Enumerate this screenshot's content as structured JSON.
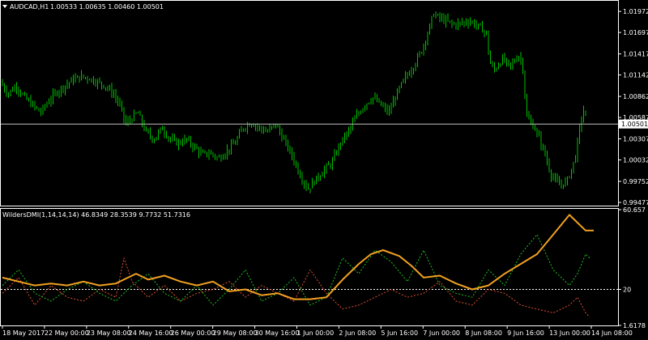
{
  "colors": {
    "background": "#000000",
    "panel_border": "#ffffff",
    "candle": "#00c000",
    "price_line": "#c0c0c0",
    "adx": "#f0a020",
    "dmi_line": "#a8d8e8",
    "plus_di": "#20c020",
    "minus_di": "#e05030",
    "text": "#ffffff"
  },
  "header": {
    "arrow_icon": "triangle-down-icon",
    "symbol": "AUDCAD,H1",
    "ohlc": "1.00533 1.00635 1.00460 1.00501"
  },
  "indicator_header": "WildersDMI(1,14,14,14) 46.8349 28.3539 9.7732 51.7316",
  "current_price_label": "1.00501",
  "chart_data": [
    {
      "type": "candlestick",
      "symbol": "AUDCAD",
      "timeframe": "H1",
      "ylim": [
        0.99435,
        1.021
      ],
      "y_ticks": [
        "1.01972",
        "1.01697",
        "1.01417",
        "1.01142",
        "1.00862",
        "1.00587",
        "1.00307",
        "1.00032",
        "0.99752",
        "0.99477"
      ],
      "y_tick_values": [
        1.01972,
        1.01697,
        1.01417,
        1.01142,
        1.00862,
        1.00587,
        1.00307,
        1.00032,
        0.99752,
        0.99477
      ],
      "current_price": 1.00501,
      "x_ticks": [
        "18 May 2017",
        "22 May 00:00",
        "23 May 08:00",
        "24 May 16:00",
        "26 May 00:00",
        "29 May 08:00",
        "30 May 16:00",
        "1 Jun 00:00",
        "2 Jun 08:00",
        "5 Jun 16:00",
        "7 Jun 00:00",
        "8 Jun 08:00",
        "9 Jun 16:00",
        "13 Jun 00:00",
        "14 Jun 08:00"
      ],
      "close_path": [
        [
          0,
          1.0105
        ],
        [
          10,
          1.009
        ],
        [
          20,
          1.01
        ],
        [
          30,
          1.0085
        ],
        [
          40,
          1.0075
        ],
        [
          50,
          1.0065
        ],
        [
          60,
          1.008
        ],
        [
          70,
          1.0092
        ],
        [
          80,
          1.01
        ],
        [
          90,
          1.0108
        ],
        [
          100,
          1.0112
        ],
        [
          110,
          1.011
        ],
        [
          120,
          1.0105
        ],
        [
          130,
          1.01
        ],
        [
          140,
          1.009
        ],
        [
          150,
          1.007
        ],
        [
          155,
          1.005
        ],
        [
          160,
          1.0055
        ],
        [
          170,
          1.0065
        ],
        [
          180,
          1.004
        ],
        [
          190,
          1.003
        ],
        [
          200,
          1.0045
        ],
        [
          210,
          1.003
        ],
        [
          220,
          1.0025
        ],
        [
          230,
          1.003
        ],
        [
          240,
          1.002
        ],
        [
          250,
          1.001
        ],
        [
          260,
          1.0012
        ],
        [
          270,
          1.0005
        ],
        [
          280,
          1.0015
        ],
        [
          290,
          1.0025
        ],
        [
          300,
          1.0045
        ],
        [
          310,
          1.0052
        ],
        [
          320,
          1.0045
        ],
        [
          330,
          1.004
        ],
        [
          340,
          1.005
        ],
        [
          350,
          1.003
        ],
        [
          360,
          1.001
        ],
        [
          370,
          0.9985
        ],
        [
          380,
          0.9965
        ],
        [
          390,
          0.9978
        ],
        [
          400,
          0.999
        ],
        [
          410,
          1.0
        ],
        [
          420,
          1.0025
        ],
        [
          430,
          1.004
        ],
        [
          440,
          1.006
        ],
        [
          450,
          1.0075
        ],
        [
          460,
          1.0085
        ],
        [
          470,
          1.0075
        ],
        [
          480,
          1.0065
        ],
        [
          490,
          1.009
        ],
        [
          500,
          1.011
        ],
        [
          510,
          1.0125
        ],
        [
          520,
          1.0145
        ],
        [
          530,
          1.0175
        ],
        [
          535,
          1.0195
        ],
        [
          540,
          1.019
        ],
        [
          550,
          1.0185
        ],
        [
          560,
          1.018
        ],
        [
          570,
          1.0182
        ],
        [
          580,
          1.0185
        ],
        [
          590,
          1.0178
        ],
        [
          600,
          1.017
        ],
        [
          605,
          1.013
        ],
        [
          610,
          1.012
        ],
        [
          620,
          1.0135
        ],
        [
          630,
          1.0125
        ],
        [
          640,
          1.014
        ],
        [
          645,
          1.013
        ],
        [
          650,
          1.006
        ],
        [
          660,
          1.0045
        ],
        [
          670,
          1.002
        ],
        [
          680,
          0.9985
        ],
        [
          690,
          0.997
        ],
        [
          700,
          0.9975
        ],
        [
          710,
          1.0005
        ],
        [
          715,
          1.004
        ],
        [
          720,
          1.007
        ],
        [
          725,
          1.005
        ]
      ]
    },
    {
      "type": "line",
      "name": "WildersDMI(1,14,14,14)",
      "values_printed": [
        46.8349,
        28.3539,
        9.7732,
        51.7316
      ],
      "ylim": [
        1.6178,
        60.657
      ],
      "y_ticks": [
        "60.657",
        "20",
        "1.6178"
      ],
      "y_tick_values": [
        60.657,
        20,
        1.6178
      ],
      "level": 20,
      "series": [
        {
          "key": "adx",
          "points": [
            [
              0,
              26
            ],
            [
              20,
              24
            ],
            [
              40,
              22
            ],
            [
              60,
              23
            ],
            [
              80,
              22
            ],
            [
              100,
              24
            ],
            [
              120,
              22
            ],
            [
              140,
              23
            ],
            [
              155,
              26
            ],
            [
              165,
              28
            ],
            [
              180,
              25
            ],
            [
              200,
              27
            ],
            [
              220,
              24
            ],
            [
              240,
              22
            ],
            [
              260,
              24
            ],
            [
              280,
              19
            ],
            [
              300,
              20
            ],
            [
              320,
              17
            ],
            [
              340,
              18
            ],
            [
              360,
              15
            ],
            [
              380,
              15
            ],
            [
              400,
              16
            ],
            [
              420,
              25
            ],
            [
              440,
              33
            ],
            [
              455,
              38
            ],
            [
              470,
              40
            ],
            [
              490,
              37
            ],
            [
              505,
              32
            ],
            [
              520,
              26
            ],
            [
              540,
              27
            ],
            [
              560,
              23
            ],
            [
              580,
              20
            ],
            [
              600,
              22
            ],
            [
              620,
              28
            ],
            [
              640,
              33
            ],
            [
              660,
              38
            ],
            [
              680,
              48
            ],
            [
              700,
              58
            ],
            [
              710,
              54
            ],
            [
              720,
              50
            ],
            [
              730,
              50
            ]
          ]
        },
        {
          "key": "dmi",
          "points": [
            [
              0,
              25
            ],
            [
              15,
              30
            ],
            [
              30,
              20
            ],
            [
              50,
              15
            ],
            [
              70,
              21
            ],
            [
              90,
              18
            ],
            [
              110,
              22
            ],
            [
              130,
              20
            ],
            [
              150,
              24
            ],
            [
              170,
              30
            ],
            [
              180,
              28
            ],
            [
              200,
              24
            ],
            [
              220,
              20
            ],
            [
              240,
              26
            ],
            [
              260,
              22
            ],
            [
              280,
              18
            ],
            [
              300,
              21
            ],
            [
              320,
              16
            ],
            [
              340,
              18
            ],
            [
              360,
              19
            ],
            [
              380,
              22
            ],
            [
              400,
              17
            ],
            [
              410,
              20
            ],
            [
              420,
              32
            ],
            [
              430,
              30
            ],
            [
              440,
              38
            ],
            [
              450,
              40
            ],
            [
              460,
              44
            ],
            [
              470,
              43
            ],
            [
              480,
              35
            ],
            [
              490,
              28
            ],
            [
              500,
              24
            ],
            [
              510,
              30
            ],
            [
              520,
              30
            ],
            [
              530,
              33
            ],
            [
              540,
              32
            ],
            [
              550,
              30
            ],
            [
              560,
              26
            ],
            [
              580,
              25
            ],
            [
              600,
              20
            ],
            [
              610,
              33
            ],
            [
              620,
              30
            ],
            [
              630,
              38
            ],
            [
              640,
              34
            ],
            [
              650,
              42
            ],
            [
              660,
              47
            ],
            [
              670,
              50
            ],
            [
              680,
              58
            ],
            [
              690,
              59
            ],
            [
              700,
              56
            ],
            [
              710,
              46
            ],
            [
              720,
              42
            ],
            [
              730,
              46
            ]
          ]
        },
        {
          "key": "plus_di",
          "dashed": true,
          "points": [
            [
              0,
              22
            ],
            [
              20,
              30
            ],
            [
              40,
              18
            ],
            [
              60,
              14
            ],
            [
              80,
              20
            ],
            [
              100,
              24
            ],
            [
              120,
              18
            ],
            [
              140,
              14
            ],
            [
              160,
              22
            ],
            [
              180,
              28
            ],
            [
              200,
              18
            ],
            [
              220,
              14
            ],
            [
              240,
              22
            ],
            [
              260,
              12
            ],
            [
              280,
              20
            ],
            [
              300,
              30
            ],
            [
              320,
              14
            ],
            [
              340,
              18
            ],
            [
              360,
              26
            ],
            [
              380,
              12
            ],
            [
              400,
              16
            ],
            [
              420,
              36
            ],
            [
              440,
              28
            ],
            [
              460,
              40
            ],
            [
              480,
              34
            ],
            [
              500,
              24
            ],
            [
              520,
              40
            ],
            [
              540,
              22
            ],
            [
              560,
              18
            ],
            [
              580,
              16
            ],
            [
              600,
              30
            ],
            [
              620,
              22
            ],
            [
              640,
              38
            ],
            [
              660,
              48
            ],
            [
              680,
              30
            ],
            [
              700,
              22
            ],
            [
              710,
              28
            ],
            [
              720,
              38
            ],
            [
              725,
              36
            ]
          ]
        },
        {
          "key": "minus_di",
          "dashed": true,
          "points": [
            [
              0,
              18
            ],
            [
              20,
              26
            ],
            [
              40,
              12
            ],
            [
              60,
              22
            ],
            [
              80,
              16
            ],
            [
              100,
              14
            ],
            [
              120,
              20
            ],
            [
              140,
              16
            ],
            [
              150,
              36
            ],
            [
              160,
              24
            ],
            [
              180,
              16
            ],
            [
              200,
              22
            ],
            [
              220,
              14
            ],
            [
              240,
              18
            ],
            [
              260,
              20
            ],
            [
              280,
              24
            ],
            [
              300,
              16
            ],
            [
              320,
              22
            ],
            [
              340,
              18
            ],
            [
              360,
              14
            ],
            [
              380,
              30
            ],
            [
              400,
              18
            ],
            [
              420,
              10
            ],
            [
              440,
              12
            ],
            [
              460,
              16
            ],
            [
              480,
              20
            ],
            [
              500,
              16
            ],
            [
              520,
              18
            ],
            [
              540,
              24
            ],
            [
              560,
              14
            ],
            [
              580,
              12
            ],
            [
              600,
              20
            ],
            [
              620,
              18
            ],
            [
              640,
              12
            ],
            [
              660,
              10
            ],
            [
              680,
              8
            ],
            [
              700,
              12
            ],
            [
              710,
              16
            ],
            [
              720,
              8
            ],
            [
              725,
              6
            ]
          ]
        }
      ]
    }
  ]
}
